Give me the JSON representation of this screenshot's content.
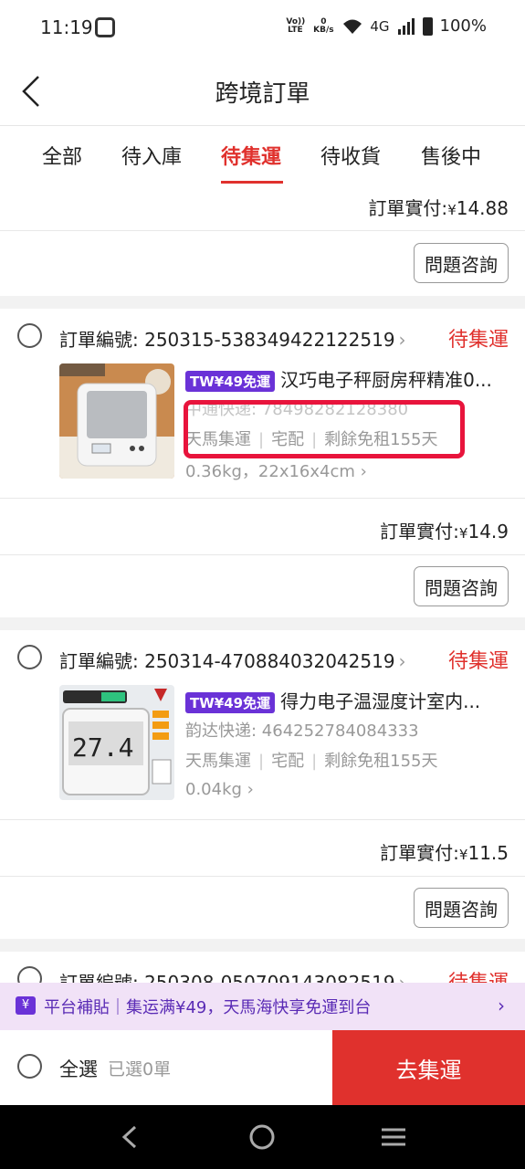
{
  "status_bar": {
    "time": "11:19",
    "volte": "Vo)) LTE",
    "speed": "0 KB/s",
    "network": "4G",
    "battery": "100%"
  },
  "header": {
    "title": "跨境訂單"
  },
  "tabs": [
    {
      "label": "全部"
    },
    {
      "label": "待入庫"
    },
    {
      "label": "待集運",
      "active": true
    },
    {
      "label": "待收貨"
    },
    {
      "label": "售後中"
    }
  ],
  "orders": [
    {
      "paid_label": "訂單實付:",
      "currency": "¥",
      "paid_amount": "14.88",
      "question_button": "問題咨詢"
    },
    {
      "order_label": "訂單編號:",
      "order_no": "250315-538349422122519",
      "status": "待集運",
      "badge": "TW¥49免運",
      "title": "汉巧电子秤厨房秤精准0...",
      "tracking": "中通快递: 78498282128380",
      "route": "天馬集運",
      "delivery": "宅配",
      "free_storage": "剩餘免租155天",
      "weight_dims": "0.36kg，22x16x4cm",
      "paid_label": "訂單實付:",
      "currency": "¥",
      "paid_amount": "14.9",
      "question_button": "問題咨詢"
    },
    {
      "order_label": "訂單編號:",
      "order_no": "250314-470884032042519",
      "status": "待集運",
      "badge": "TW¥49免運",
      "title": "得力电子温湿度计室内...",
      "tracking": "韵达快递: 464252784084333",
      "route": "天馬集運",
      "delivery": "宅配",
      "free_storage": "剩餘免租155天",
      "weight_dims": "0.04kg",
      "paid_label": "訂單實付:",
      "currency": "¥",
      "paid_amount": "11.5",
      "question_button": "問題咨詢"
    },
    {
      "order_label": "訂單編號:",
      "order_no": "250308-050709143082519",
      "status": "待集運"
    }
  ],
  "promo": {
    "icon": "¥",
    "text": "平台補貼｜集运满¥49，天馬海快享免運到台"
  },
  "bottom": {
    "select_all": "全選",
    "selected": "已選0單",
    "consolidate": "去集運"
  },
  "colors": {
    "accent": "#e0312d",
    "badge": "#6a32d7",
    "promo_bg": "#f1e2f7",
    "highlight": "#e8143c"
  }
}
